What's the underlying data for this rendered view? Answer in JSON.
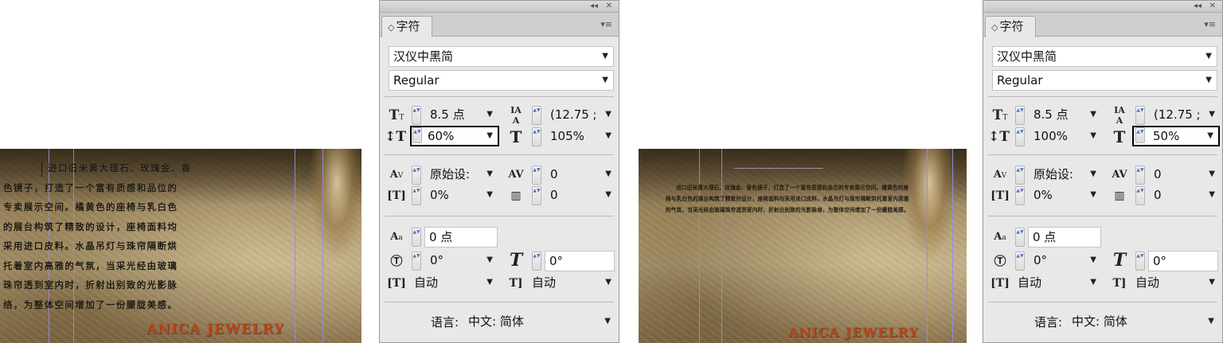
{
  "left_doc": {
    "text_lines": [
      "进口旧米黄大理石、玫瑰金、香",
      "色镜子，打造了一个富有质感和品位的",
      "专卖展示空间。橘黄色的座椅与乳白色",
      "的展台构筑了精致的设计，座椅面料均",
      "采用进口皮料。水晶吊灯与珠帘隔断烘",
      "托着室内高雅的气氛，当采光经由玻璃",
      "珠帘透到室内时，折射出别致的光影脉",
      "络，为整体空间增加了一份朦胧美感。"
    ],
    "brand": "ANICA JEWELRY"
  },
  "right_doc": {
    "paragraph": "进口旧米黄大理石、玫瑰金、香色镜子，打造了一个富有质感和品位的专卖展示空间。橘黄色的座椅与乳白色的展台构筑了精致的设计，座椅面料均采用进口皮料。水晶吊灯与珠帘隔断烘托着室内高雅的气氛，当采光经由玻璃珠帘透到室内时，折射出别致的光影脉络，为整体空间增加了一份朦胧美感。",
    "brand": "ANICA JEWELRY"
  },
  "panel_left": {
    "collapse": "◂◂",
    "close": "✕",
    "tab_symbol": "◇",
    "tab_label": "字符",
    "menu_icon": "▾≡",
    "font_family": "汉仪中黑简",
    "font_style": "Regular",
    "font_size": "8.5 点",
    "leading": "(12.75 ;",
    "vertical_scale": "60%",
    "horizontal_scale": "105%",
    "kerning": "原始设:",
    "tracking": "0",
    "tsume": "0%",
    "grid_spacing": "0",
    "baseline_shift": "0 点",
    "rotation": "0°",
    "skew": "0°",
    "aki_before": "自动",
    "aki_after": "自动",
    "language_label": "语言:",
    "language": "中文: 简体"
  },
  "panel_right": {
    "collapse": "◂◂",
    "close": "✕",
    "tab_symbol": "◇",
    "tab_label": "字符",
    "menu_icon": "▾≡",
    "font_family": "汉仪中黑简",
    "font_style": "Regular",
    "font_size": "8.5 点",
    "leading": "(12.75 ;",
    "vertical_scale": "100%",
    "horizontal_scale": "50%",
    "kerning": "原始设:",
    "tracking": "0",
    "tsume": "0%",
    "grid_spacing": "0",
    "baseline_shift": "0 点",
    "rotation": "0°",
    "skew": "0°",
    "aki_before": "自动",
    "aki_after": "自动",
    "language_label": "语言:",
    "language": "中文: 简体"
  },
  "icons": {
    "dropdown_arrow": "▼",
    "spin": "▲▼"
  }
}
